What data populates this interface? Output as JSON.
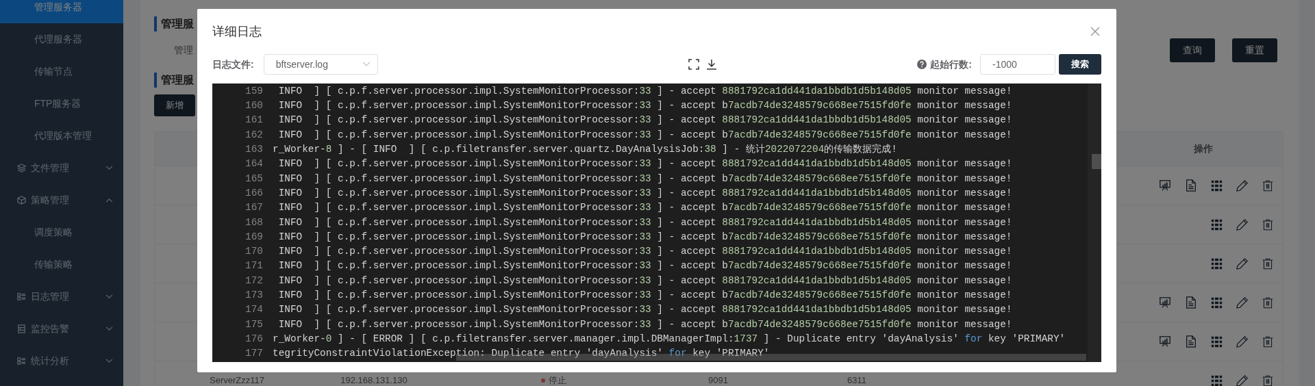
{
  "sidebar": {
    "items": [
      {
        "kind": "link",
        "label": "管理服务器",
        "selected": true
      },
      {
        "kind": "link",
        "label": "代理服务器",
        "selected": false
      },
      {
        "kind": "link",
        "label": "传输节点",
        "selected": false
      },
      {
        "kind": "link",
        "label": "FTP服务器",
        "selected": false
      },
      {
        "kind": "link",
        "label": "代理版本管理",
        "selected": false
      },
      {
        "kind": "group",
        "label": "文件管理",
        "expanded": false
      },
      {
        "kind": "group",
        "label": "策略管理",
        "expanded": true,
        "children": [
          {
            "kind": "link",
            "label": "调度策略",
            "selected": false
          },
          {
            "kind": "link",
            "label": "传输策略",
            "selected": false
          }
        ]
      },
      {
        "kind": "group",
        "label": "日志管理",
        "expanded": false
      },
      {
        "kind": "group",
        "label": "监控告警",
        "expanded": false
      },
      {
        "kind": "group",
        "label": "统计分析",
        "expanded": false
      }
    ]
  },
  "page": {
    "section_title": "管理服",
    "filter_label": "管理",
    "buttons": [
      "查询",
      "重置"
    ],
    "list_title": "管理服",
    "add_button": "新增",
    "table": {
      "action_header": "操作",
      "rows": [
        {
          "extra_actions": true
        },
        {
          "extra_actions": false
        },
        {
          "extra_actions": false
        },
        {
          "extra_actions": true
        },
        {
          "extra_actions": true
        },
        {
          "extra_actions": false,
          "name": "ServerZzz117",
          "ip": "192.168.131.130",
          "status": "停止",
          "color": "#7b3636",
          "port": "9091",
          "column_5": "6311"
        }
      ]
    }
  },
  "dialog": {
    "title": "详细日志",
    "file_label": "日志文件:",
    "file_value": "bftserver.log",
    "start_label": "起始行数:",
    "start_value": "-1000",
    "search_button": "搜索",
    "lines": [
      {
        "number": "159",
        "text": " INFO  ] [ c.p.f.server.processor.impl.SystemMonitorProcessor:33 ] - accept 8881792ca1dd441da1bbdb1d5b148d05 monitor message!"
      },
      {
        "number": "160",
        "text": " INFO  ] [ c.p.f.server.processor.impl.SystemMonitorProcessor:33 ] - accept b7acdb74de3248579c668ee7515fd0fe monitor message!"
      },
      {
        "number": "161",
        "text": " INFO  ] [ c.p.f.server.processor.impl.SystemMonitorProcessor:33 ] - accept 8881792ca1dd441da1bbdb1d5b148d05 monitor message!"
      },
      {
        "number": "162",
        "text": " INFO  ] [ c.p.f.server.processor.impl.SystemMonitorProcessor:33 ] - accept b7acdb74de3248579c668ee7515fd0fe monitor message!"
      },
      {
        "number": "163",
        "text": "r_Worker-8 ] - [ INFO  ] [ c.p.filetransfer.server.quartz.DayAnalysisJob:38 ] - 统计2022072204的传输数据完成!"
      },
      {
        "number": "164",
        "text": " INFO  ] [ c.p.f.server.processor.impl.SystemMonitorProcessor:33 ] - accept 8881792ca1dd441da1bbdb1d5b148d05 monitor message!"
      },
      {
        "number": "165",
        "text": " INFO  ] [ c.p.f.server.processor.impl.SystemMonitorProcessor:33 ] - accept b7acdb74de3248579c668ee7515fd0fe monitor message!"
      },
      {
        "number": "166",
        "text": " INFO  ] [ c.p.f.server.processor.impl.SystemMonitorProcessor:33 ] - accept 8881792ca1dd441da1bbdb1d5b148d05 monitor message!"
      },
      {
        "number": "167",
        "text": " INFO  ] [ c.p.f.server.processor.impl.SystemMonitorProcessor:33 ] - accept b7acdb74de3248579c668ee7515fd0fe monitor message!"
      },
      {
        "number": "168",
        "text": " INFO  ] [ c.p.f.server.processor.impl.SystemMonitorProcessor:33 ] - accept 8881792ca1dd441da1bbdb1d5b148d05 monitor message!"
      },
      {
        "number": "169",
        "text": " INFO  ] [ c.p.f.server.processor.impl.SystemMonitorProcessor:33 ] - accept b7acdb74de3248579c668ee7515fd0fe monitor message!"
      },
      {
        "number": "170",
        "text": " INFO  ] [ c.p.f.server.processor.impl.SystemMonitorProcessor:33 ] - accept 8881792ca1dd441da1bbdb1d5b148d05 monitor message!"
      },
      {
        "number": "171",
        "text": " INFO  ] [ c.p.f.server.processor.impl.SystemMonitorProcessor:33 ] - accept b7acdb74de3248579c668ee7515fd0fe monitor message!"
      },
      {
        "number": "172",
        "text": " INFO  ] [ c.p.f.server.processor.impl.SystemMonitorProcessor:33 ] - accept 8881792ca1dd441da1bbdb1d5b148d05 monitor message!"
      },
      {
        "number": "173",
        "text": " INFO  ] [ c.p.f.server.processor.impl.SystemMonitorProcessor:33 ] - accept b7acdb74de3248579c668ee7515fd0fe monitor message!"
      },
      {
        "number": "174",
        "text": " INFO  ] [ c.p.f.server.processor.impl.SystemMonitorProcessor:33 ] - accept 8881792ca1dd441da1bbdb1d5b148d05 monitor message!"
      },
      {
        "number": "175",
        "text": " INFO  ] [ c.p.f.server.processor.impl.SystemMonitorProcessor:33 ] - accept b7acdb74de3248579c668ee7515fd0fe monitor message!"
      },
      {
        "number": "176",
        "text": "r_Worker-0 ] - [ ERROR ] [ c.p.filetransfer.server.manager.impl.DBManagerImpl:1737 ] - Duplicate entry 'dayAnalysis' for key 'PRIMARY'"
      },
      {
        "number": "177",
        "text": "tegrityConstraintViolationException: Duplicate entry 'dayAnalysis' for key 'PRIMARY'"
      }
    ]
  }
}
